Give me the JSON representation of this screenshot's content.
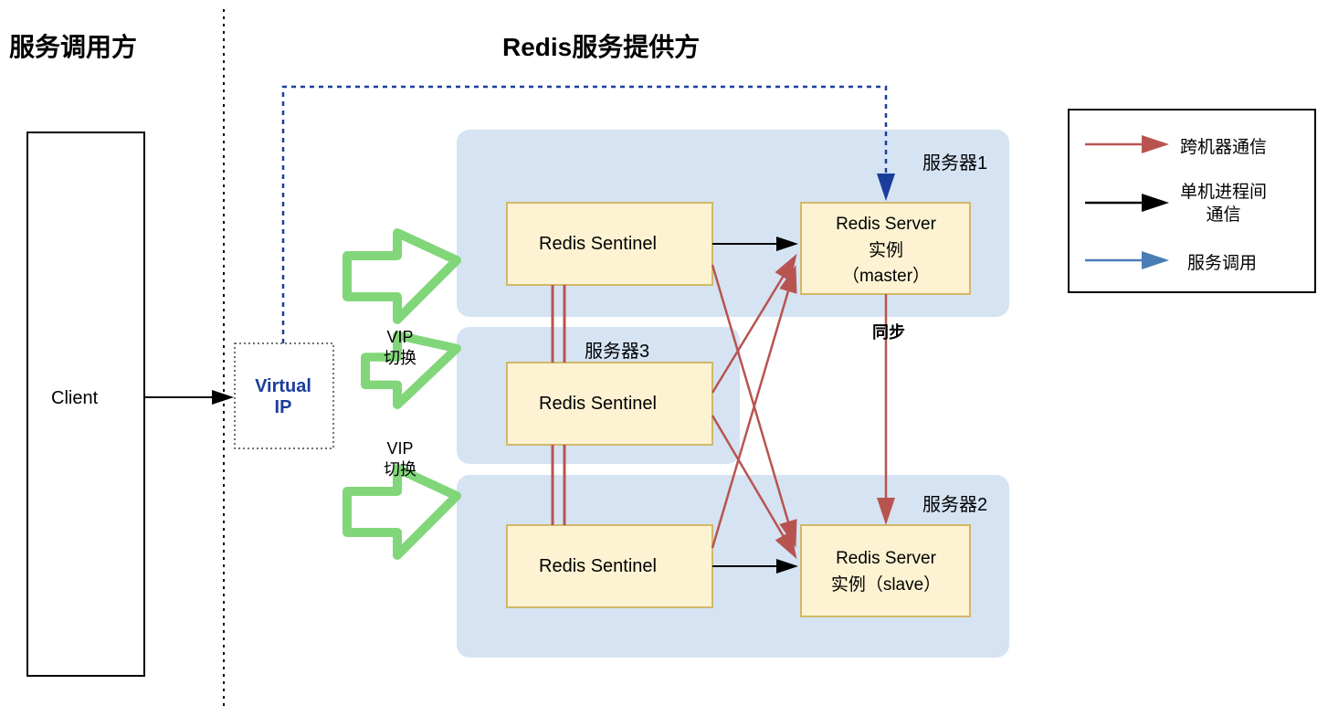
{
  "titles": {
    "client_side": "服务调用方",
    "server_side": "Redis服务提供方"
  },
  "boxes": {
    "client": "Client",
    "virtual_ip": "Virtual\nIP",
    "sentinel1": "Redis Sentinel",
    "sentinel2": "Redis Sentinel",
    "sentinel3": "Redis Sentinel",
    "master": "Redis Server\n实例\n（master）",
    "slave": "Redis Server\n实例（slave）"
  },
  "server_labels": {
    "server1": "服务器1",
    "server2": "服务器2",
    "server3": "服务器3"
  },
  "annotations": {
    "vip_switch1": "VIP\n切换",
    "vip_switch2": "VIP\n切换",
    "sync": "同步"
  },
  "legend": {
    "cross_machine": "跨机器通信",
    "single_machine": "单机进程间\n通信",
    "service_call": "服务调用"
  },
  "colors": {
    "server_bg": "#d5e3f3",
    "box_fill": "#fdf3d2",
    "box_stroke": "#d2b86a",
    "red_arrow": "#b85450",
    "blue_arrow": "#4a7db5",
    "green_arrow": "#82d67a",
    "blue_text": "#1a3e9c"
  }
}
